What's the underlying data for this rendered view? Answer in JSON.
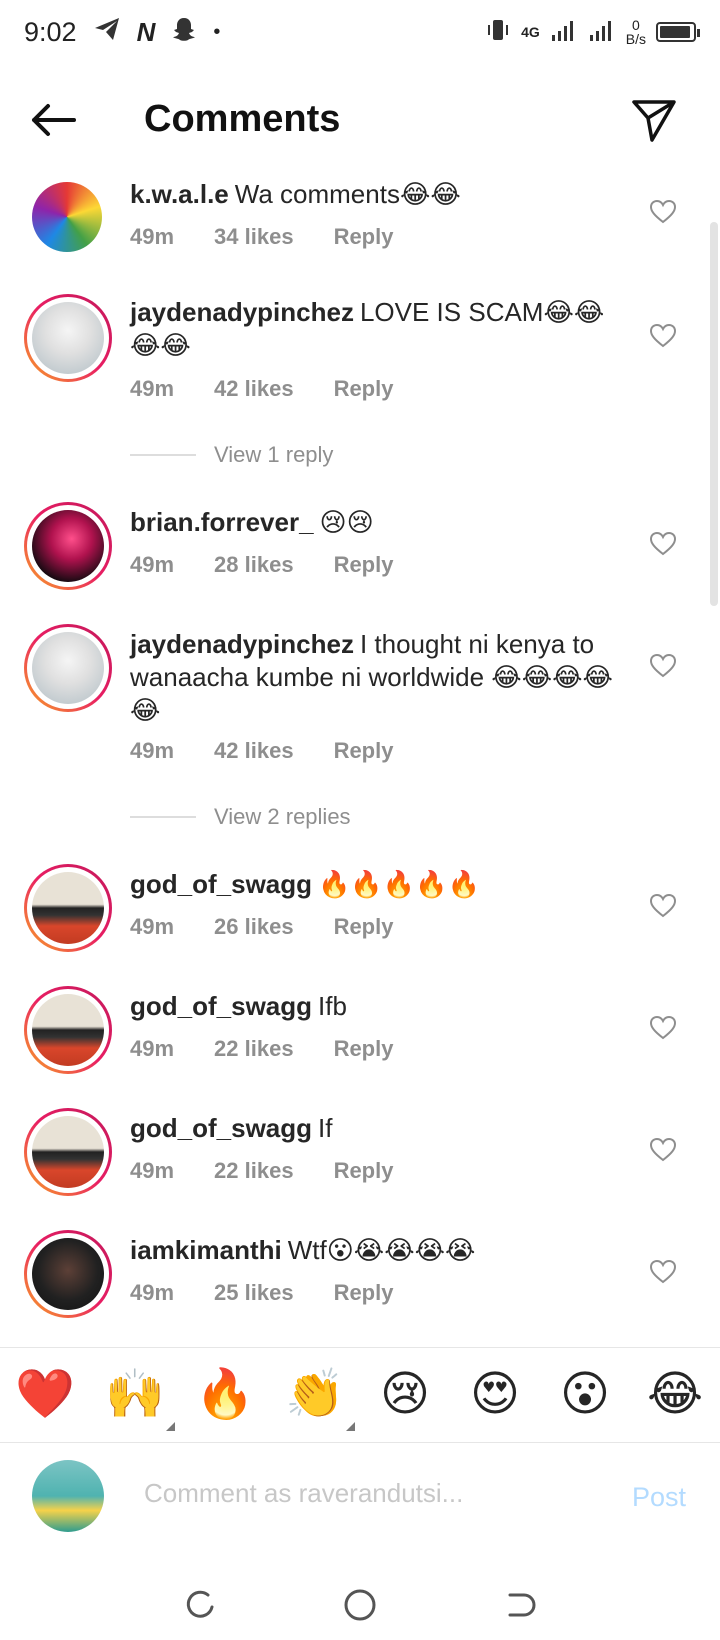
{
  "status": {
    "time": "9:02",
    "network": "4G",
    "speed_value": "0",
    "speed_unit": "B/s"
  },
  "header": {
    "title": "Comments"
  },
  "comments": [
    {
      "user": "k.w.a.l.e",
      "text": "Wa comments😂😂",
      "time": "49m",
      "likes": "34 likes",
      "reply": "Reply"
    },
    {
      "user": "jaydenadypinchez",
      "text": "LOVE IS SCAM😂😂😂😂",
      "time": "49m",
      "likes": "42 likes",
      "reply": "Reply"
    },
    {
      "user": "brian.forrever_",
      "text": "😢😢",
      "time": "49m",
      "likes": "28 likes",
      "reply": "Reply"
    },
    {
      "user": "jaydenadypinchez",
      "text": "I thought ni kenya to wanaacha kumbe ni worldwide 😂😂😂😂😂",
      "time": "49m",
      "likes": "42 likes",
      "reply": "Reply"
    },
    {
      "user": "god_of_swagg",
      "text": "🔥🔥🔥🔥🔥",
      "time": "49m",
      "likes": "26 likes",
      "reply": "Reply"
    },
    {
      "user": "god_of_swagg",
      "text": "Ifb",
      "time": "49m",
      "likes": "22 likes",
      "reply": "Reply"
    },
    {
      "user": "god_of_swagg",
      "text": "If",
      "time": "49m",
      "likes": "22 likes",
      "reply": "Reply"
    },
    {
      "user": "iamkimanthi",
      "text": "Wtf😮😭😭😭😭",
      "time": "49m",
      "likes": "25 likes",
      "reply": "Reply"
    }
  ],
  "view_replies": [
    "View 1 reply",
    "View 2 replies"
  ],
  "reactions": [
    "❤️",
    "🙌",
    "🔥",
    "👏",
    "😢",
    "😍",
    "😮",
    "😂"
  ],
  "composer": {
    "placeholder": "Comment as raverandutsi...",
    "post_label": "Post"
  },
  "colors": {
    "accent_post": "#b3dbff",
    "muted_text": "#8e8e8e",
    "story_ring_start": "#f9a825",
    "story_ring_end": "#c2185b"
  }
}
